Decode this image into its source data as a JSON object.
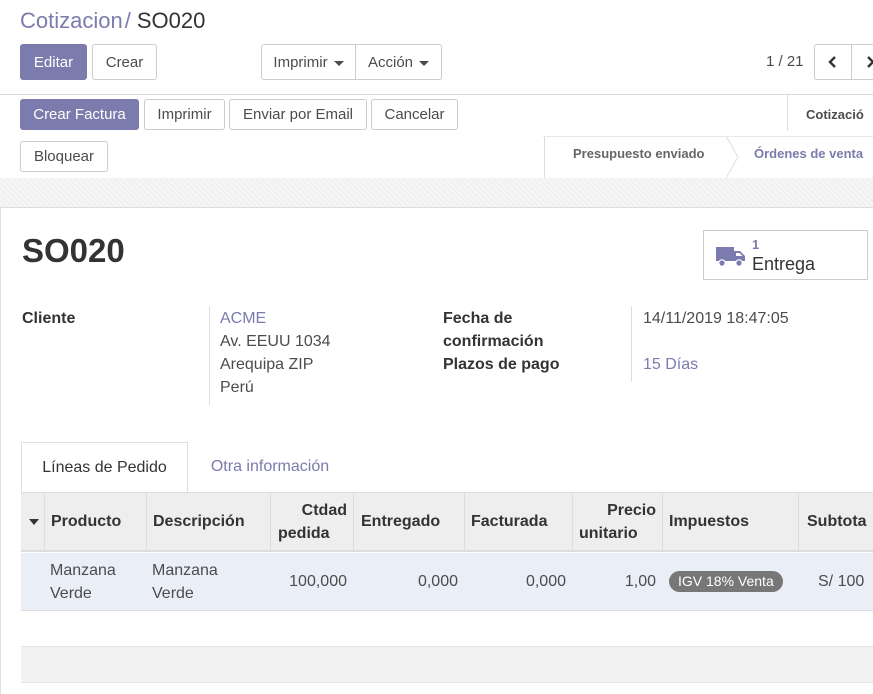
{
  "breadcrumb": {
    "parent": "Cotizacion",
    "separator": "/",
    "current": "SO020"
  },
  "toolbar": {
    "edit_label": "Editar",
    "create_label": "Crear",
    "print_label": "Imprimir",
    "action_label": "Acción"
  },
  "pager": {
    "value": "1 / 21"
  },
  "header_buttons": {
    "create_invoice": "Crear Factura",
    "print": "Imprimir",
    "send_email": "Enviar por Email",
    "cancel": "Cancelar",
    "lock": "Bloquear"
  },
  "statusbar": {
    "top_label": "Cotizació",
    "stages": [
      "Presupuesto enviado",
      "Órdenes de venta"
    ],
    "active_stage_index": 1
  },
  "record": {
    "name": "SO020",
    "smart_button": {
      "count": "1",
      "label": "Entrega"
    },
    "customer_label": "Cliente",
    "customer_name": "ACME",
    "customer_address": [
      "Av. EEUU 1034",
      "Arequipa ZIP",
      "Perú"
    ],
    "confirmation_label_line1": "Fecha de",
    "confirmation_label_line2": "confirmación",
    "confirmation_date": "14/11/2019 18:47:05",
    "payment_terms_label": "Plazos de pago",
    "payment_terms": "15 Días"
  },
  "tabs": [
    "Líneas de Pedido",
    "Otra información"
  ],
  "table": {
    "headers": {
      "product": "Producto",
      "description": "Descripción",
      "qty_line1": "Ctdad",
      "qty_line2": "pedida",
      "delivered": "Entregado",
      "invoiced": "Facturada",
      "price_line1": "Precio",
      "price_line2": "unitario",
      "taxes": "Impuestos",
      "subtotal": "Subtota"
    },
    "rows": [
      {
        "product_line1": "Manzana",
        "product_line2": "Verde",
        "description_line1": "Manzana",
        "description_line2": "Verde",
        "qty": "100,000",
        "delivered": "0,000",
        "invoiced": "0,000",
        "price": "1,00",
        "tax": "IGV 18% Venta",
        "subtotal": "S/ 100"
      }
    ]
  },
  "colors": {
    "accent": "#7c7bad",
    "badge": "#777777",
    "row_highlight": "#eaeef7"
  }
}
